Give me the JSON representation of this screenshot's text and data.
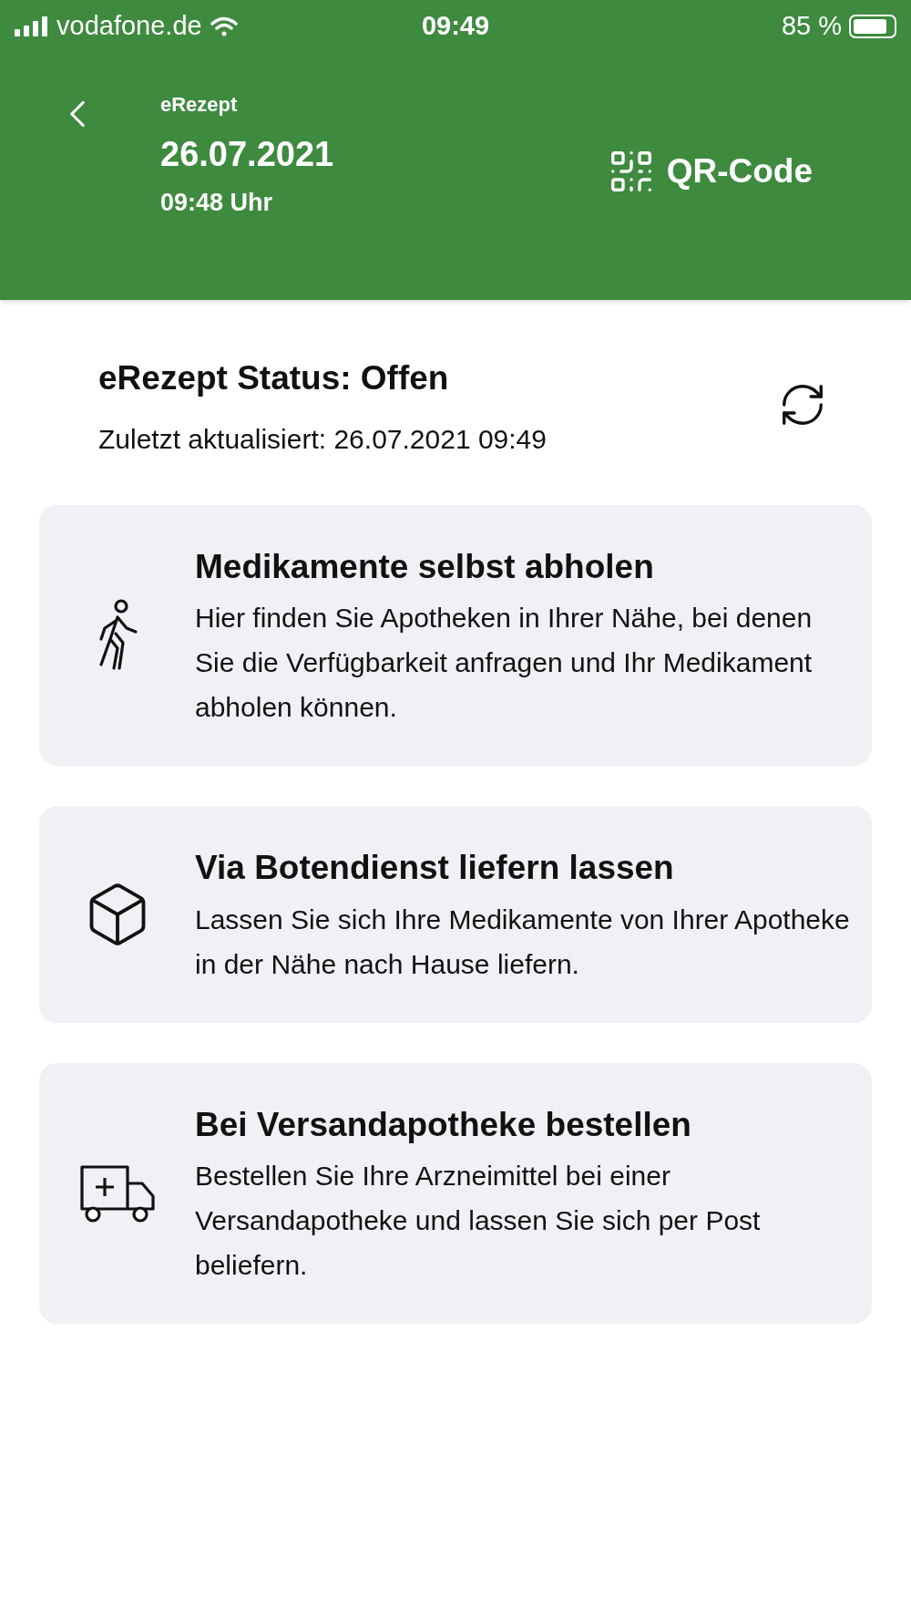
{
  "status_bar": {
    "carrier": "vodafone.de",
    "time": "09:49",
    "battery": "85 %"
  },
  "header": {
    "label": "eRezept",
    "date": "26.07.2021",
    "time": "09:48 Uhr",
    "qr_button": "QR-Code"
  },
  "status": {
    "title": "eRezept Status: Offen",
    "updated": "Zuletzt aktualisiert: 26.07.2021 09:49"
  },
  "options": [
    {
      "kind": "walk",
      "title": "Medikamente selbst abholen",
      "description": "Hier finden Sie Apotheken in Ihrer Nähe, bei denen Sie die Verfügbarkeit anfragen und Ihr Medikament abholen können."
    },
    {
      "kind": "delivery",
      "title": "Via Botendienst liefern lassen",
      "description": "Lassen Sie sich Ihre Medikamente von Ihrer Apotheke in der Nähe nach Hause liefern."
    },
    {
      "kind": "mail",
      "title": "Bei Versandapotheke bestellen",
      "description": "Bestellen Sie Ihre Arzneimittel bei einer Versandapotheke und lassen Sie sich per Post beliefern."
    }
  ]
}
